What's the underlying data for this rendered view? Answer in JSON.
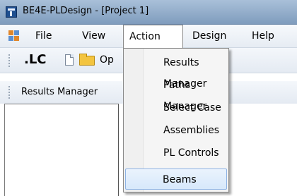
{
  "window": {
    "title": "BE4E-PLDesign - [Project 1]"
  },
  "menubar": {
    "items": [
      {
        "label": "File"
      },
      {
        "label": "View"
      },
      {
        "label": "Action"
      },
      {
        "label": "Design"
      },
      {
        "label": "Help"
      }
    ]
  },
  "toolbar": {
    "lc_label": ".LC",
    "open_label": "Op"
  },
  "toolbar2": {
    "label": "Results Manager"
  },
  "action_menu": {
    "items": [
      {
        "label": "Results Manager"
      },
      {
        "label": "Paths Manager"
      },
      {
        "label": "Select Case"
      },
      {
        "label": "Assemblies"
      },
      {
        "label": "PL Controls"
      },
      {
        "label": "Beams"
      }
    ],
    "highlighted": "Beams"
  },
  "colors": {
    "highlight": "#d7e8fb",
    "titlebar": "#a9c0d9"
  }
}
